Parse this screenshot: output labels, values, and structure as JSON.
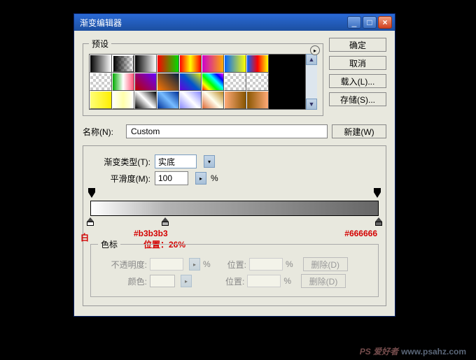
{
  "window": {
    "title": "渐变编辑器"
  },
  "buttons": {
    "ok": "确定",
    "cancel": "取消",
    "load": "载入(L)...",
    "save": "存储(S)...",
    "new": "新建(W)"
  },
  "presets": {
    "label": "预设"
  },
  "name": {
    "label": "名称(N):",
    "value": "Custom"
  },
  "gradientType": {
    "label": "渐变类型(T):",
    "value": "实底"
  },
  "smoothness": {
    "label": "平滑度(M):",
    "value": "100",
    "unit": "%"
  },
  "stops": {
    "legend": "色标",
    "opacity_label": "不透明度:",
    "position_label": "位置:",
    "color_label": "颜色:",
    "percent": "%",
    "delete": "删除(D)"
  },
  "annotations": {
    "white": "白",
    "b3": "#b3b3b3",
    "pos": "位置：26%",
    "grey": "#666666"
  },
  "chart_data": {
    "type": "gradient",
    "stops": [
      {
        "color": "#ffffff",
        "position_pct": 0,
        "label": "白"
      },
      {
        "color": "#b3b3b3",
        "position_pct": 26,
        "label": "#b3b3b3"
      },
      {
        "color": "#666666",
        "position_pct": 100,
        "label": "#666666"
      }
    ]
  },
  "watermark": {
    "main": "PS 爱好者",
    "sub": "www.psahz.com"
  }
}
